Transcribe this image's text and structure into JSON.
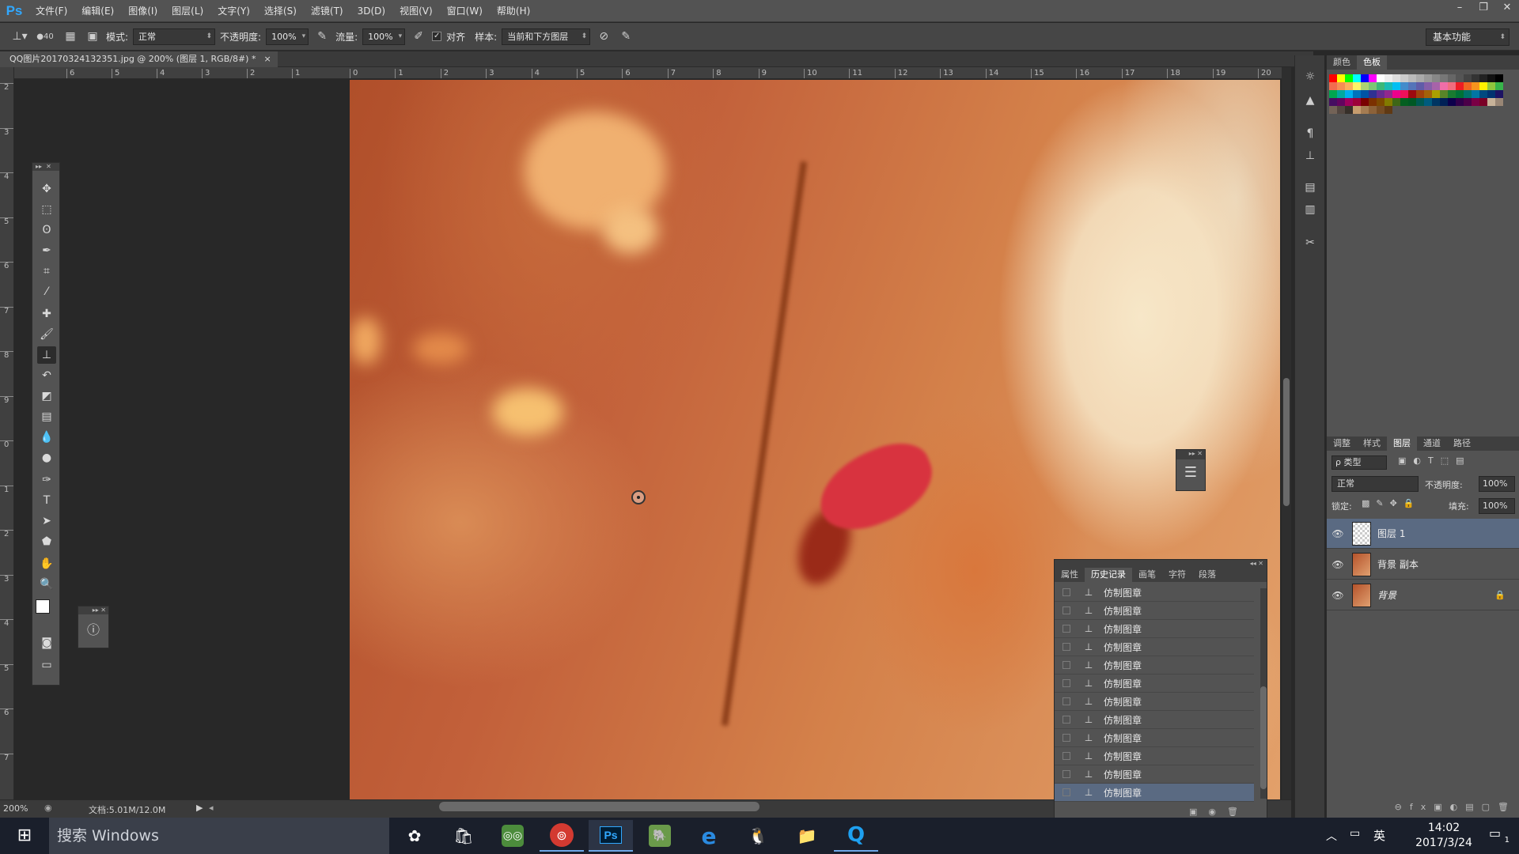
{
  "menu": [
    "文件(F)",
    "编辑(E)",
    "图像(I)",
    "图层(L)",
    "文字(Y)",
    "选择(S)",
    "滤镜(T)",
    "3D(D)",
    "视图(V)",
    "窗口(W)",
    "帮助(H)"
  ],
  "options": {
    "brush_size": "40",
    "mode_label": "模式:",
    "mode_value": "正常",
    "opacity_label": "不透明度:",
    "opacity_value": "100%",
    "flow_label": "流量:",
    "flow_value": "100%",
    "align_label": "对齐",
    "sample_label": "样本:",
    "sample_value": "当前和下方图层",
    "workspace": "基本功能"
  },
  "document": {
    "tab_title": "QQ图片20170324132351.jpg @ 200% (图层 1, RGB/8#) *",
    "close": "×"
  },
  "ruler_h": [
    "1",
    "0",
    "1",
    "2",
    "3",
    "4",
    "5",
    "6",
    "7",
    "8",
    "9",
    "10",
    "11",
    "12",
    "13",
    "14",
    "15",
    "16",
    "17",
    "18",
    "19",
    "20"
  ],
  "ruler_h_left": [
    "6",
    "5",
    "4",
    "3",
    "2",
    "1"
  ],
  "ruler_v": [
    "2",
    "3",
    "4",
    "5",
    "6",
    "7",
    "8",
    "9",
    "0",
    "1",
    "2",
    "3",
    "4",
    "5",
    "6",
    "7"
  ],
  "status": {
    "zoom": "200%",
    "doc": "文档:5.01M/12.0M"
  },
  "right": {
    "top_tabs": [
      "颜色",
      "色板"
    ],
    "layer_tabs": [
      "调整",
      "样式",
      "图层",
      "通道",
      "路径"
    ],
    "kind_label": "ρ 类型",
    "blend": "正常",
    "opacity_label": "不透明度:",
    "opacity_value": "100%",
    "lock_label": "锁定:",
    "fill_label": "填充:",
    "fill_value": "100%"
  },
  "layers": [
    {
      "name": "图层 1",
      "selected": true
    },
    {
      "name": "背景 副本",
      "selected": false
    },
    {
      "name": "背景",
      "selected": false,
      "locked": true
    }
  ],
  "history": {
    "tabs": [
      "属性",
      "历史记录",
      "画笔",
      "字符",
      "段落"
    ],
    "items": [
      "仿制图章",
      "仿制图章",
      "仿制图章",
      "仿制图章",
      "仿制图章",
      "仿制图章",
      "仿制图章",
      "仿制图章",
      "仿制图章",
      "仿制图章",
      "仿制图章",
      "仿制图章"
    ]
  },
  "taskbar": {
    "search": "搜索 Windows",
    "ime": "英",
    "time": "14:02",
    "date": "2017/3/24",
    "notify": "1"
  },
  "colors": {
    "accent": "#31a8ff",
    "selection": "#5a6a82",
    "lips": "#d8333f"
  }
}
